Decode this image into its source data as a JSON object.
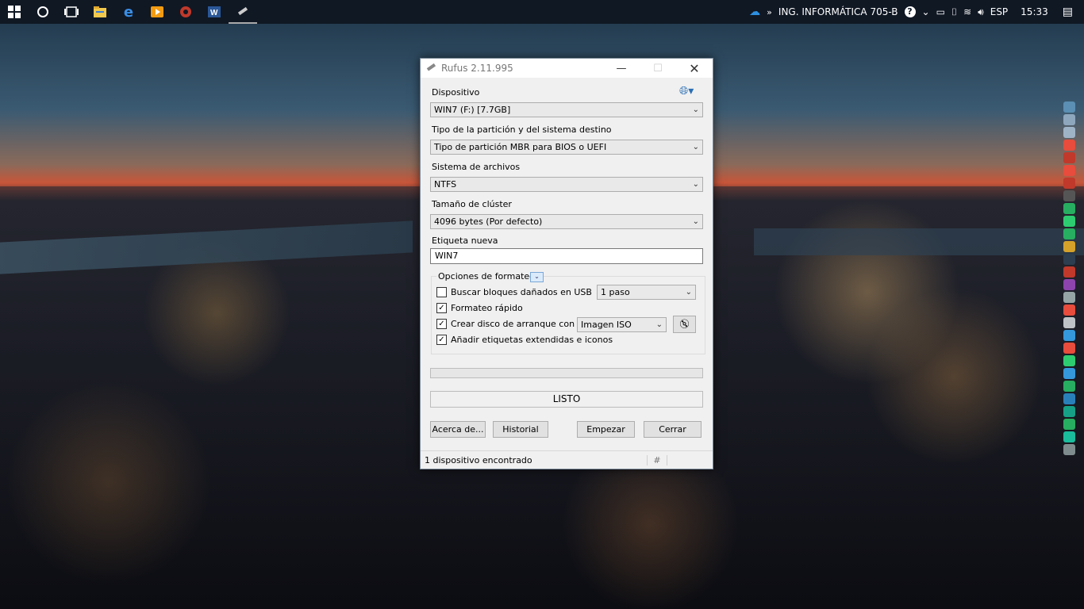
{
  "taskbar": {
    "icons": [
      "windows-start-icon",
      "cortana-icon",
      "task-view-icon",
      "file-explorer-icon",
      "edge-icon",
      "media-player-icon",
      "opera-icon",
      "word-icon",
      "rufus-icon"
    ],
    "tray": {
      "network_name": "ING. INFORMÁTICA 705-B",
      "language": "ESP",
      "time": "15:33"
    }
  },
  "window": {
    "title": "Rufus 2.11.995",
    "device_label": "Dispositivo",
    "device_value": "WIN7 (F:) [7.7GB]",
    "partition_label": "Tipo de la partición y del sistema destino",
    "partition_value": "Tipo de partición MBR para BIOS o UEFI",
    "filesystem_label": "Sistema de archivos",
    "filesystem_value": "NTFS",
    "cluster_label": "Tamaño de clúster",
    "cluster_value": "4096 bytes (Por defecto)",
    "volume_label": "Etiqueta nueva",
    "volume_value": "WIN7",
    "format_options_label": "Opciones de formateo",
    "bad_blocks_label": "Buscar bloques dañados en USB",
    "bad_blocks_checked": false,
    "passes_value": "1 paso",
    "quick_format_label": "Formateo rápido",
    "quick_format_checked": true,
    "bootable_label": "Crear disco de arranque con",
    "bootable_checked": true,
    "boot_type_value": "Imagen ISO",
    "extended_label": "Añadir etiquetas extendidas e iconos",
    "extended_checked": true,
    "status_text": "LISTO",
    "progress": 0,
    "about_button": "Acerca de...",
    "history_button": "Historial",
    "start_button": "Empezar",
    "close_button": "Cerrar",
    "statusbar_text": "1 dispositivo encontrado",
    "statusbar_hash": "#"
  }
}
